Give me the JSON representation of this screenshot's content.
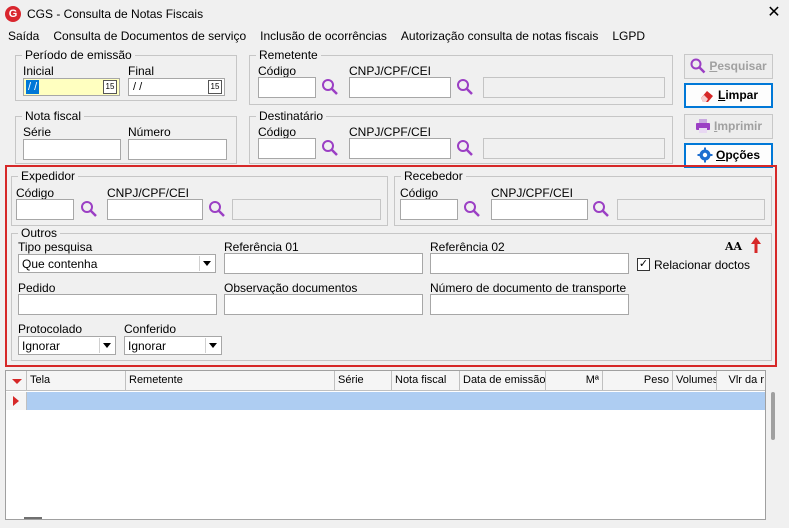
{
  "window": {
    "title": "CGS - Consulta de Notas Fiscais",
    "logo_letter": "G",
    "close": "✕"
  },
  "menu": [
    "Saída",
    "Consulta de Documentos de serviço",
    "Inclusão de ocorrências",
    "Autorização consulta de notas fiscais",
    "LGPD"
  ],
  "periodo": {
    "title": "Período de emissão",
    "inicial_label": "Inicial",
    "inicial_value": " / /",
    "final_label": "Final",
    "final_value": " / /",
    "cal_glyph": "15"
  },
  "remetente": {
    "title": "Remetente",
    "codigo_label": "Código",
    "cnpj_label": "CNPJ/CPF/CEI"
  },
  "nota_fiscal": {
    "title": "Nota fiscal",
    "serie_label": "Série",
    "numero_label": "Número"
  },
  "destinatario": {
    "title": "Destinatário",
    "codigo_label": "Código",
    "cnpj_label": "CNPJ/CPF/CEI"
  },
  "expedidor": {
    "title": "Expedidor",
    "codigo_label": "Código",
    "cnpj_label": "CNPJ/CPF/CEI"
  },
  "recebedor": {
    "title": "Recebedor",
    "codigo_label": "Código",
    "cnpj_label": "CNPJ/CPF/CEI"
  },
  "outros": {
    "title": "Outros",
    "tipo_label": "Tipo pesquisa",
    "tipo_value": "Que contenha",
    "ref01_label": "Referência 01",
    "ref02_label": "Referência 02",
    "relacionar_label": "Relacionar doctos",
    "relacionar_checked": "✓",
    "pedido_label": "Pedido",
    "obs_label": "Observação documentos",
    "num_transp_label": "Número de documento de transporte",
    "protocolado_label": "Protocolado",
    "protocolado_value": "Ignorar",
    "conferido_label": "Conferido",
    "conferido_value": "Ignorar",
    "font_icon_text": "AA"
  },
  "buttons": {
    "pesquisar_pre": "",
    "pesquisar_u": "P",
    "pesquisar_post": "esquisar",
    "limpar_u": "L",
    "limpar_post": "impar",
    "imprimir_u": "I",
    "imprimir_post": "mprimir",
    "opcoes_u": "O",
    "opcoes_post": "pções"
  },
  "grid": {
    "columns": [
      "Tela",
      "Remetente",
      "Série",
      "Nota fiscal",
      "Data de emissão",
      "Mª",
      "Peso",
      "Volumes",
      "Vlr da r"
    ]
  },
  "colors": {
    "accent": "#0078d7",
    "highlight": "#d62828",
    "row_selected": "#aecdf2",
    "magnifier": "#9b3fc4"
  }
}
